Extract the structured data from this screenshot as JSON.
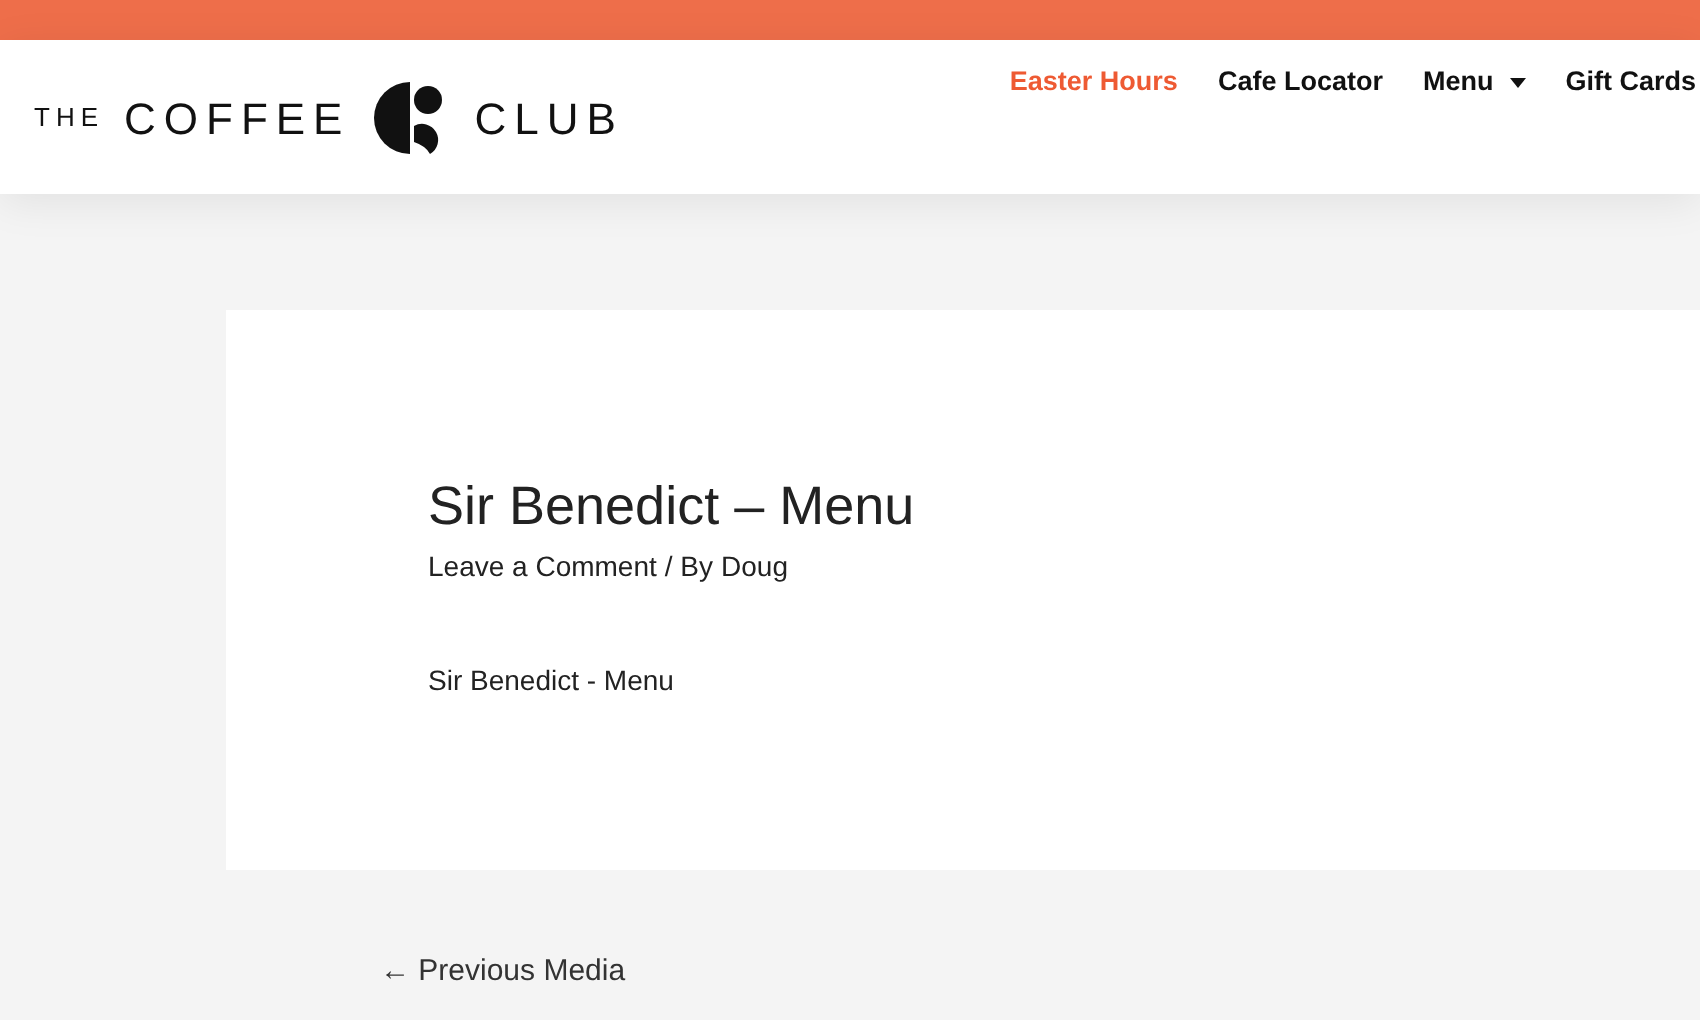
{
  "logo": {
    "words": [
      "THE",
      "COFFEE",
      "CLUB"
    ]
  },
  "nav": [
    {
      "label": "Easter Hours",
      "selected": true,
      "dropdown": false
    },
    {
      "label": "Cafe Locator",
      "selected": false,
      "dropdown": false
    },
    {
      "label": "Menu",
      "selected": false,
      "dropdown": true
    },
    {
      "label": "Gift Cards",
      "selected": false,
      "dropdown": false
    }
  ],
  "post": {
    "title": "Sir Benedict – Menu",
    "meta": {
      "comment_link": "Leave a Comment",
      "separator": "/ By",
      "author": "Doug"
    },
    "body": "Sir Benedict - Menu"
  },
  "pagination": {
    "previous": "← Previous Media"
  }
}
